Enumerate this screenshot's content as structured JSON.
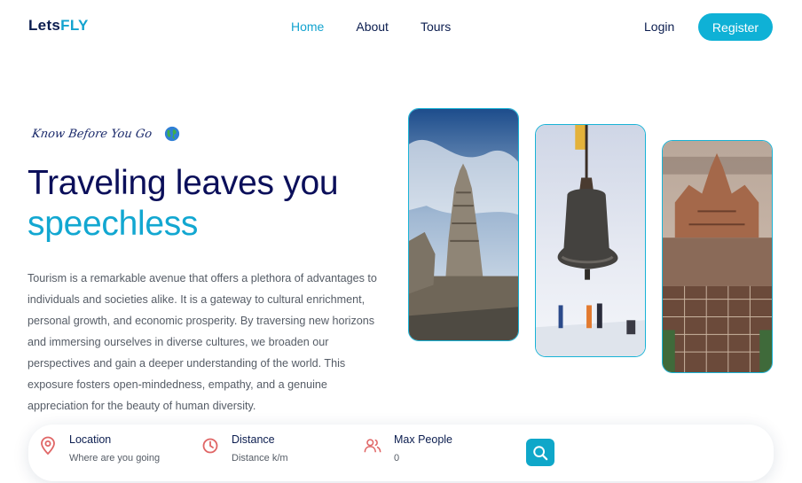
{
  "brand": {
    "part1": "Lets",
    "part2": "FLY"
  },
  "nav": {
    "items": [
      {
        "label": "Home",
        "active": true
      },
      {
        "label": "About",
        "active": false
      },
      {
        "label": "Tours",
        "active": false
      }
    ],
    "login_label": "Login",
    "register_label": "Register"
  },
  "hero": {
    "tagline": "Know Before You Go",
    "title_line1": "Traveling leaves you",
    "title_line2": "speechless",
    "description": "Tourism is a remarkable avenue that offers a plethora of advantages to individuals and societies alike. It is a gateway to cultural enrichment, personal growth, and economic prosperity. By traversing new horizons and immersing ourselves in diverse cultures, we broaden our perspectives and gain a deeper understanding of the world. This exposure fosters open-mindedness, empathy, and a genuine appreciation for the beauty of human diversity."
  },
  "search": {
    "fields": [
      {
        "label": "Location",
        "placeholder": "Where are you going"
      },
      {
        "label": "Distance",
        "placeholder": "Distance k/m"
      },
      {
        "label": "Max People",
        "placeholder": "0"
      }
    ]
  },
  "colors": {
    "accent": "#12a7d1",
    "navy": "#0b1d4f",
    "icon_red": "#e06666"
  }
}
